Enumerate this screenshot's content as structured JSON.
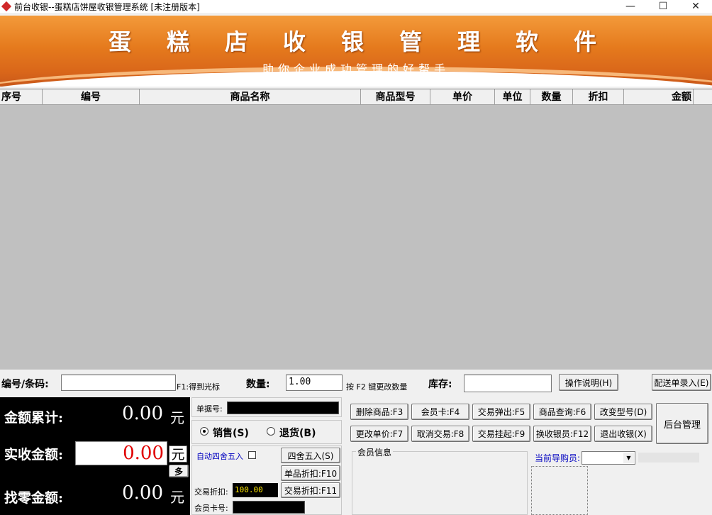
{
  "window": {
    "title": "前台收银--蛋糕店饼屋收银管理系统 [未注册版本]",
    "minimize": "—",
    "maximize": "☐",
    "close": "✕"
  },
  "banner": {
    "title": "蛋糕店收银管理软件",
    "subtitle": "助你企业成功管理的好帮手"
  },
  "table": {
    "columns": [
      "序号",
      "编号",
      "商品名称",
      "商品型号",
      "单价",
      "单位",
      "数量",
      "折扣",
      "金额"
    ]
  },
  "scan": {
    "code_label": "编号/条码:",
    "code_value": "",
    "f1_hint": "F1:得到光标",
    "qty_label": "数量:",
    "qty_value": "1.00",
    "f2_hint": "按 F2 键更改数量",
    "stock_label": "库存:",
    "stock_value": "",
    "help_button": "操作说明(H)",
    "delivery_button": "配送单录入(E)"
  },
  "totals": {
    "sum_label": "金额累计:",
    "sum_value": "0.00",
    "paid_label": "实收金额:",
    "paid_value": "0.00",
    "change_label": "找零金额:",
    "change_value": "0.00",
    "yuan": "元",
    "more_button": "多"
  },
  "middle": {
    "receipt_label": "单据号:",
    "sale_label": "销售(S)",
    "return_label": "退货(B)",
    "auto_round_label": "自动四舍五入",
    "round_button": "四舍五入(S)",
    "item_discount_button": "单品折扣:F10",
    "trade_discount_label": "交易折扣:",
    "trade_discount_value": "100.00",
    "trade_discount_button": "交易折扣:F11",
    "member_card_label": "会员卡号:"
  },
  "actions": {
    "row1": [
      "删除商品:F3",
      "会员卡:F4",
      "交易弹出:F5",
      "商品查询:F6",
      "改变型号(D)"
    ],
    "row2": [
      "更改单价:F7",
      "取消交易:F8",
      "交易挂起:F9",
      "换收银员:F12",
      "退出收银(X)"
    ],
    "admin_button": "后台管理",
    "member_info_label": "会员信息",
    "guide_label": "当前导购员:"
  },
  "colors": {
    "banner_orange": "#e57a1d",
    "red_amount": "#e00000",
    "blue_label": "#0000c0"
  }
}
